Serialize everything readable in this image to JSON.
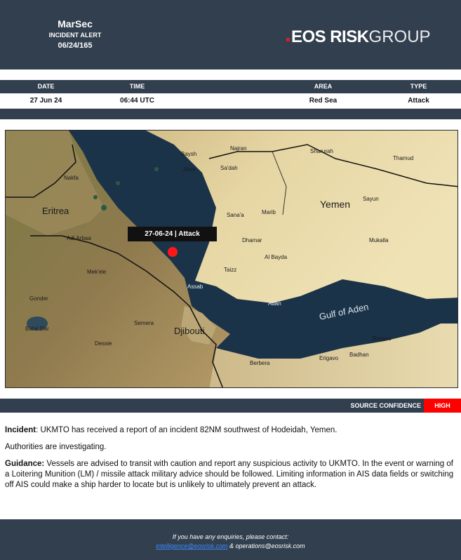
{
  "header": {
    "brand": "MarSec",
    "subtitle": "INCIDENT ALERT",
    "ref": "06/24/165",
    "logo": {
      "eos": "EOS",
      "risk": "RISK",
      "group": "GROUP"
    }
  },
  "incident_table": {
    "headers": {
      "date": "DATE",
      "time": "TIME",
      "area": "AREA",
      "type": "TYPE"
    },
    "row": {
      "date": "27 Jun 24",
      "time": "06:44 UTC",
      "area": "Red Sea",
      "type": "Attack"
    }
  },
  "map": {
    "callout": "27-06-24 | Attack",
    "labels": {
      "eritrea": "Eritrea",
      "yemen": "Yemen",
      "djibouti": "Djibouti",
      "gulf": "Gulf of Aden",
      "bayshi": "Baysh",
      "jizan": "Jizan",
      "najran": "Najran",
      "sharurah": "Sharurah",
      "thamud": "Thamud",
      "sada": "Sa'dah",
      "sanaa": "Sana'a",
      "marib": "Marib",
      "sayun": "Sayun",
      "mukalla": "Mukalla",
      "dhamar": "Dhamar",
      "albayda": "Al Bayda",
      "taizz": "Taizz",
      "aden": "Adan",
      "assab": "Assab",
      "nakfa": "Nakfa",
      "adiarbaa": "Adi Arbaa",
      "mekele": "Mek'ele",
      "gonder": "Gonder",
      "bahirdar": "Bahir Dar",
      "semera": "Semera",
      "dessie": "Dessie",
      "bosaso": "Bosaso",
      "berbera": "Berbera",
      "erigavo": "Erigavo",
      "badhan": "Badhan"
    }
  },
  "confidence": {
    "label": "SOURCE CONFIDENCE",
    "value": "HIGH",
    "value_color": "#ff0000"
  },
  "body": {
    "incident_label": "Incident",
    "incident_text": ": UKMTO has received a report of an incident 82NM southwest of Hodeidah, Yemen.",
    "status": "Authorities are investigating.",
    "guidance_label": "Guidance:",
    "guidance_text": " Vessels are advised to transit with caution and report any suspicious activity to UKMTO. In the event or warning of a Loitering Munition (LM) / missile attack military advice should be followed. Limiting information in AIS data fields or switching off AIS could make a ship harder to locate but is unlikely to ultimately prevent an attack."
  },
  "footer": {
    "line1": "If you have any enquiries, please contact:",
    "email1": "intelligence@eosrisk.com",
    "joiner": " & operations@eosrisk.com"
  },
  "colors": {
    "header_bg": "#323f4f",
    "accent_red": "#d32027",
    "pin": "#ff1717"
  }
}
